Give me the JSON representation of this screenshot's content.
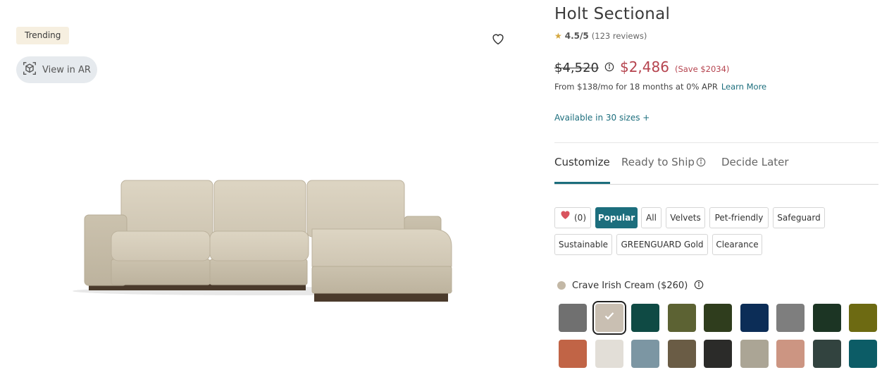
{
  "gallery": {
    "badge": "Trending",
    "ar_label": "View in AR"
  },
  "product": {
    "title": "Holt Sectional",
    "rating": "4.5/5",
    "reviews": "(123 reviews)",
    "price_old": "$4,520",
    "price_new": "$2,486",
    "save": "(Save $2034)",
    "financing": "From $138/mo for 18 months at 0% APR",
    "learn_more": "Learn More",
    "sizes": "Available in 30 sizes +"
  },
  "tabs": [
    "Customize",
    "Ready to Ship",
    "Decide Later"
  ],
  "filters": {
    "favorites_count": "(0)",
    "chips": [
      "Popular",
      "All",
      "Velvets",
      "Pet-friendly",
      "Safeguard",
      "Sustainable",
      "GREENGUARD Gold",
      "Clearance"
    ]
  },
  "fabric": {
    "selected_name": "Crave Irish Cream ($260)",
    "selected_color": "#c3b8a6"
  },
  "swatches": [
    {
      "color": "#707070",
      "selected": false
    },
    {
      "color": "#c9bfb2",
      "selected": true
    },
    {
      "color": "#0f4a44",
      "selected": false
    },
    {
      "color": "#5c6233",
      "selected": false
    },
    {
      "color": "#2f3d1d",
      "selected": false
    },
    {
      "color": "#0c2d57",
      "selected": false
    },
    {
      "color": "#7e7e7e",
      "selected": false
    },
    {
      "color": "#1c3524",
      "selected": false
    },
    {
      "color": "#6d6a12",
      "selected": false
    },
    {
      "color": "#c16446",
      "selected": false
    },
    {
      "color": "#e2ded7",
      "selected": false
    },
    {
      "color": "#7c96a3",
      "selected": false
    },
    {
      "color": "#6a5c45",
      "selected": false
    },
    {
      "color": "#2b2b29",
      "selected": false
    },
    {
      "color": "#aba595",
      "selected": false
    },
    {
      "color": "#cc9582",
      "selected": false
    },
    {
      "color": "#32433f",
      "selected": false
    },
    {
      "color": "#0c5c66",
      "selected": false
    }
  ],
  "colors": {
    "accent": "#1c6e7d",
    "sale": "#b5434e",
    "rating_star": "#d4a73d",
    "fabric": "#d7cfbd"
  }
}
